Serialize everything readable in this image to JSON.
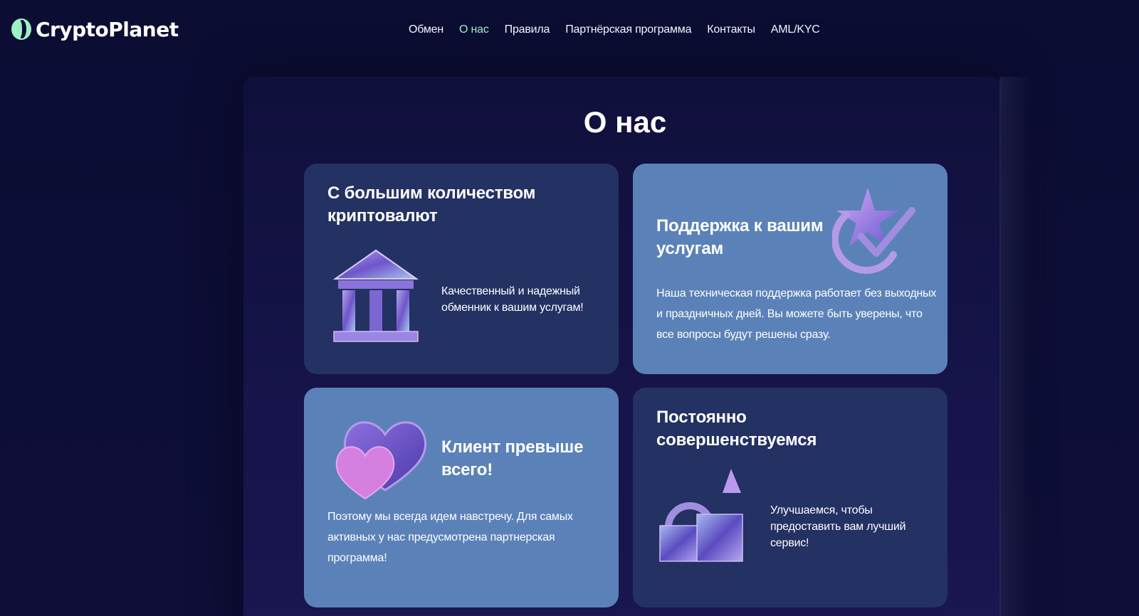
{
  "brand": {
    "name": "CryptoPlanet",
    "accent": "#9ef0c4",
    "background": "#0c0d33",
    "card_dark": "#243163",
    "card_light": "#5b82b8"
  },
  "nav": {
    "items": [
      {
        "label": "Обмен",
        "active": false
      },
      {
        "label": "О нас",
        "active": true
      },
      {
        "label": "Правила",
        "active": false
      },
      {
        "label": "Партнёрская программа",
        "active": false
      },
      {
        "label": "Контакты",
        "active": false
      },
      {
        "label": "AML/KYC",
        "active": false
      }
    ]
  },
  "main": {
    "title": "О нас",
    "cards": [
      {
        "title": "С большим количеством криптовалют",
        "text": "Качественный и надежный обменник к вашим услугам!",
        "icon": "bank-building-icon"
      },
      {
        "title": "Поддержка к вашим услугам",
        "text": "Наша техническая поддержка работает без выходных и праздничных дней. Вы можете быть уверены, что все вопросы будут решены сразу.",
        "icon": "star-check-icon"
      },
      {
        "title": "Клиент превыше всего!",
        "text": "Поэтому мы всегда идем навстречу. Для самых активных у нас предусмотрена партнерская программа!",
        "icon": "hearts-icon"
      },
      {
        "title": "Постоянно совершенствуемся",
        "text": "Улучшаемся, чтобы предоставить вам лучший сервис!",
        "icon": "shapes-icon"
      }
    ]
  }
}
